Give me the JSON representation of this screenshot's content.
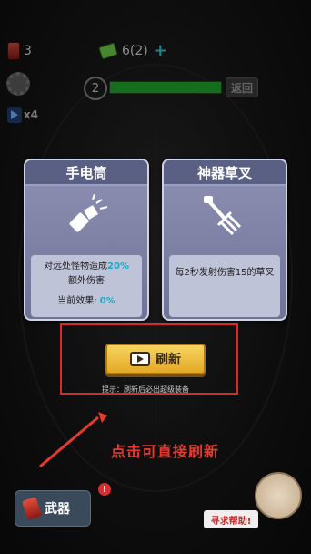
{
  "hud": {
    "battery_count": "3",
    "gems": "6(2)",
    "plus": "+",
    "speed": "x4",
    "wave": "2",
    "wave_progress": 1,
    "back_label": "返回"
  },
  "cards": [
    {
      "title": "手电筒",
      "icon": "flashlight-icon",
      "desc_prefix": "对远处怪物造成",
      "desc_highlight": "20%",
      "desc_suffix": "额外伤害",
      "effect_label": "当前效果:",
      "effect_value": "0%"
    },
    {
      "title": "神器草叉",
      "icon": "pitchfork-icon",
      "desc": "每2秒发射伤害15的草叉"
    }
  ],
  "refresh": {
    "label": "刷新",
    "tip": "提示：刷新后必出超级装备"
  },
  "hint": "点击可直接刷新",
  "bottom": {
    "weapon_label": "武器",
    "badge": "!",
    "help_label": "寻求帮助!"
  },
  "colors": {
    "highlight": "#1aa9c5",
    "frame": "#d92a2a",
    "hint": "#e43a2f"
  }
}
